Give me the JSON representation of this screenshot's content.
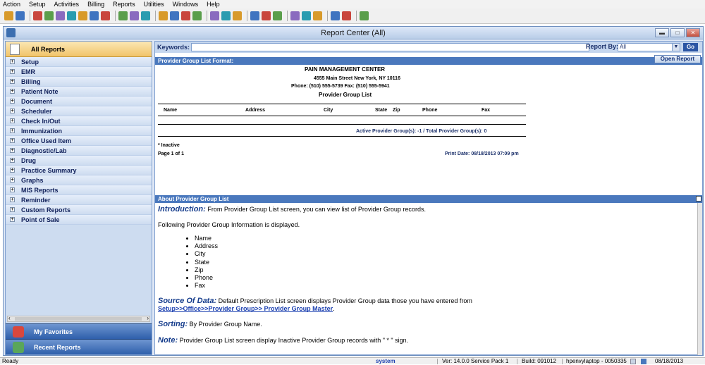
{
  "menu": [
    "Action",
    "Setup",
    "Activities",
    "Billing",
    "Reports",
    "Utilities",
    "Windows",
    "Help"
  ],
  "toolbar_icons": [
    "user-icon",
    "users-icon",
    "folder-icon",
    "printer-icon",
    "book-icon",
    "flask-icon",
    "dollar-icon",
    "dollar-icon",
    "dollar-icon",
    "dollar-icon",
    "list-icon",
    "chart-icon",
    "calendar-icon",
    "note-icon",
    "pill-icon",
    "document-icon",
    "vial-icon",
    "group-icon",
    "grid-icon",
    "scan-icon",
    "refresh-icon",
    "transfer-icon",
    "word-icon",
    "email-icon",
    "print-icon",
    "help-icon",
    "lock-icon",
    "exit-icon"
  ],
  "window": {
    "title": "Report Center (All)",
    "min": "▬",
    "max": "□",
    "close": "✕"
  },
  "sidebar": {
    "header": "All Reports",
    "items": [
      "Setup",
      "EMR",
      "Billing",
      "Patient Note",
      "Document",
      "Scheduler",
      "Check In/Out",
      "Immunization",
      "Office Used Item",
      "Diagnostic/Lab",
      "Drug",
      "Practice Summary",
      "Graphs",
      "MIS Reports",
      "Reminder",
      "Custom Reports",
      "Point of Sale"
    ],
    "expand_glyph": "+",
    "scroll_left": "‹",
    "scroll_right": "›",
    "favorites": "My Favorites",
    "recent": "Recent Reports"
  },
  "search": {
    "keywords_label": "Keywords:",
    "keywords_value": "",
    "report_by_label": "Report By:",
    "report_by_value": "All",
    "go_label": "Go"
  },
  "report": {
    "section_title": "Provider Group List Format:",
    "open_button": "Open Report",
    "org_name": "PAIN MANAGEMENT CENTER",
    "address": "4555 Main Street    New York, NY 10116",
    "phone_fax": "Phone: (510) 555-5739  Fax: (510) 555-5941",
    "title": "Provider Group List",
    "columns": [
      "Name",
      "Address",
      "City",
      "State",
      "Zip",
      "Phone",
      "Fax"
    ],
    "summary": "Active Provider Group(s): -1 / Total Provider Group(s): 0",
    "inactive_note": "* Inactive",
    "page": "Page 1 of 1",
    "print_date": "Print Date: 08/18/2013 07:09 pm"
  },
  "about": {
    "section_title": "About Provider Group List",
    "intro_label": "Introduction:",
    "intro_text": " From Provider Group List screen, you can view list of Provider Group records.",
    "following": "Following Provider Group Information is displayed.",
    "fields": [
      "Name",
      "Address",
      "City",
      "State",
      "Zip",
      "Phone",
      "Fax"
    ],
    "source_label": "Source Of Data:",
    "source_text": " Default Prescription List screen displays Provider Group data those you have entered from",
    "source_link": "Setup>>Office>>Provider Group>> Provider Group Master",
    "source_end": ".",
    "sorting_label": "Sorting:",
    "sorting_text": " By Provider Group Name.",
    "note_label": "Note:",
    "note_text": " Provider Group List screen display Inactive Provider Group records with \" * \" sign."
  },
  "status": {
    "ready": "Ready",
    "user": "system",
    "version": "Ver: 14.0.0 Service Pack 1",
    "build": "Build: 091012",
    "machine": "hpenvylaptop - 0050335",
    "date": "08/18/2013"
  },
  "colors": {
    "accent": "#4a78bd",
    "header_gold": "#f1c46a",
    "link": "#1a3fb0"
  }
}
